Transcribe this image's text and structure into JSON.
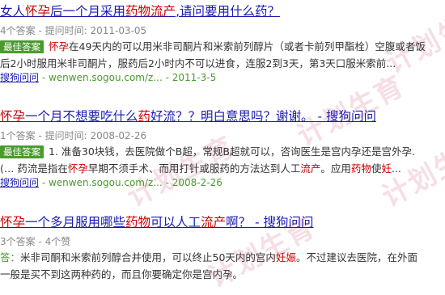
{
  "watermark": {
    "text": "计划生育",
    "color": "#e5a0b4"
  },
  "results": [
    {
      "title_parts": [
        {
          "text": "女人",
          "hl": false
        },
        {
          "text": "怀孕",
          "hl": true
        },
        {
          "text": "后一个月采用",
          "hl": false
        },
        {
          "text": "药物流产",
          "hl": true
        },
        {
          "text": ",请问要用什么药？",
          "hl": false
        }
      ],
      "meta": "4个答案 - 提问时间: 2011-03-05",
      "badge": "最佳答案",
      "snippet_line1_parts": [
        {
          "text": "怀孕",
          "hl": true
        },
        {
          "text": "在49天内的可以用米非司酮片和米索前列醇片（或者卡前列甲酯栓）空腹或者饭",
          "hl": false
        }
      ],
      "snippet_line2_parts": [
        {
          "text": "后2小时服用米非司酮片，服药后2小时内不可以进食，连服2到3天，第3天口服米索前...",
          "hl": false
        }
      ],
      "source_name": "搜狗问问",
      "source_rest": " - wenwen.sogou.com/z... - 2011-3-5"
    },
    {
      "title_parts": [
        {
          "text": "怀孕",
          "hl": true
        },
        {
          "text": "一个月不想要吃什么",
          "hl": false
        },
        {
          "text": "药",
          "hl": true
        },
        {
          "text": "好流？？明白意思吗？谢谢。 - 搜狗问问",
          "hl": false
        }
      ],
      "meta": "1个答案 - 提问时间: 2008-02-26",
      "badge": "最佳答案",
      "snippet_line1_parts": [
        {
          "text": "1. 准备30块钱，去医院做个B超，常规B超就可以，咨询医生是宫内孕还是宫外孕.",
          "hl": false
        }
      ],
      "snippet_line2_parts": [
        {
          "text": "(… 药流是指在",
          "hl": false
        },
        {
          "text": "怀孕",
          "hl": true
        },
        {
          "text": "早期不须手术、而用打针或服药的方法达到人工",
          "hl": false
        },
        {
          "text": "流产",
          "hl": true
        },
        {
          "text": "。应用",
          "hl": false
        },
        {
          "text": "药物",
          "hl": true
        },
        {
          "text": "使",
          "hl": false
        },
        {
          "text": "妊",
          "hl": true
        },
        {
          "text": "...",
          "hl": false
        }
      ],
      "source_name": "搜狗问问",
      "source_rest": " - wenwen.sogou.com/z... - 2008-2-26"
    },
    {
      "title_parts": [
        {
          "text": "怀孕",
          "hl": true
        },
        {
          "text": "一个多月服用哪些",
          "hl": false
        },
        {
          "text": "药物",
          "hl": true
        },
        {
          "text": "可以人工",
          "hl": false
        },
        {
          "text": "流产",
          "hl": true
        },
        {
          "text": "啊？ - 搜狗问问",
          "hl": false
        }
      ],
      "meta": "3个答案 - 4个赞",
      "answer_lead": "答：",
      "snippet_line1_parts": [
        {
          "text": "米非司酮和米索前列醇合并使用，可以终止50天内的宫内",
          "hl": false
        },
        {
          "text": "妊娠",
          "hl": true
        },
        {
          "text": "。不过建议去医院，在外面",
          "hl": false
        }
      ],
      "snippet_line2_parts": [
        {
          "text": "一般是买不到这两种药的，而且你要确定你是宫内孕。",
          "hl": false
        }
      ]
    }
  ]
}
